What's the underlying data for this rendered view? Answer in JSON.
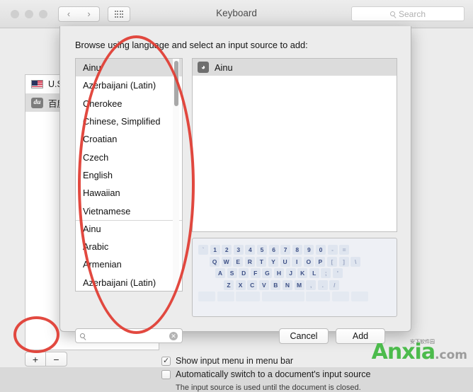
{
  "window": {
    "title": "Keyboard",
    "traffic_lights": [
      "close",
      "minimize",
      "zoom"
    ],
    "nav": {
      "back": "‹",
      "forward": "›"
    },
    "grid_icon": "grid-icon",
    "search": {
      "placeholder": "Search",
      "icon": "search-icon"
    }
  },
  "background": {
    "input_sources": [
      {
        "name": "U.S.",
        "icon": "us-flag-icon",
        "selected": false
      },
      {
        "name": "百度",
        "icon": "baidu-du-icon",
        "selected": true
      }
    ],
    "add_button": "+",
    "remove_button": "−",
    "checkboxes": [
      {
        "label": "Show input menu in menu bar",
        "checked": true
      },
      {
        "label": "Automatically switch to a document's input source",
        "checked": false
      }
    ],
    "note": "The input source is used until the document is closed."
  },
  "sheet": {
    "title": "Browse using language and select an input source to add:",
    "languages_primary": [
      "Ainu",
      "Azerbaijani (Latin)",
      "Cherokee",
      "Chinese, Simplified",
      "Croatian",
      "Czech",
      "English",
      "Hawaiian",
      "Vietnamese"
    ],
    "languages_secondary": [
      "Ainu",
      "Arabic",
      "Armenian",
      "Azerbaijani (Latin)"
    ],
    "selected_language": "Ainu",
    "source_panel": {
      "items": [
        {
          "name": "Ainu",
          "icon": "input-source-icon",
          "selected": true
        }
      ]
    },
    "search": {
      "value": "",
      "placeholder": "",
      "icon": "search-icon",
      "clear_icon": "clear-icon"
    },
    "buttons": {
      "cancel": "Cancel",
      "add": "Add"
    },
    "keyboard_preview": {
      "row1": [
        "`",
        "1",
        "2",
        "3",
        "4",
        "5",
        "6",
        "7",
        "8",
        "9",
        "0",
        "-",
        "="
      ],
      "row2": [
        "Q",
        "W",
        "E",
        "R",
        "T",
        "Y",
        "U",
        "I",
        "O",
        "P",
        "[",
        "]",
        "\\"
      ],
      "row3": [
        "A",
        "S",
        "D",
        "F",
        "G",
        "H",
        "J",
        "K",
        "L",
        ";",
        "'"
      ],
      "row4": [
        "Z",
        "X",
        "C",
        "V",
        "B",
        "N",
        "M",
        ",",
        ".",
        "/"
      ]
    }
  },
  "annotations": {
    "ellipse_color": "#e03a30",
    "shapes": [
      "language-list-ellipse",
      "add-button-ellipse"
    ]
  },
  "watermark": {
    "main": "Anxia",
    "domain": ".com",
    "subtitle": "安下软件园"
  }
}
